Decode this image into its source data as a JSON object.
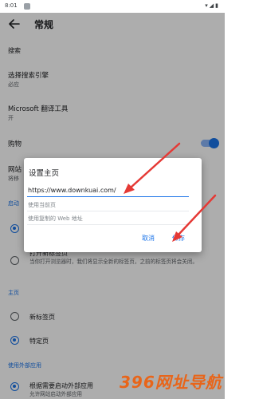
{
  "status_bar": {
    "time": "8:01",
    "indicators": "▾◢▮"
  },
  "header": {
    "title": "常规"
  },
  "settings": {
    "search_section": "搜索",
    "search_engine_title": "选择搜索引擎",
    "search_engine_value": "必应",
    "translator_title": "Microsoft 翻译工具",
    "translator_value": "开",
    "shopping_title": "购物",
    "partial_row_title": "网站",
    "partial_row_sub": "将移",
    "startup_partial": "启动",
    "open_newtab_title": "打开新标签页",
    "open_newtab_desc": "当你打开浏览器时，我们将显示全新的标签页，之前的标签页将会关闭。",
    "home_section": "主页",
    "home_newtab": "新标签页",
    "home_specific": "特定页",
    "external_apps_section": "使用外部应用",
    "external_apps_title": "根据需要启动外部应用",
    "external_apps_desc": "允许网站启动外部应用"
  },
  "dialog": {
    "title": "设置主页",
    "input_value": "https://www.downkuai.com/",
    "option_current": "使用当前页",
    "option_clipboard": "使用复制的 Web 地址",
    "cancel_label": "取消",
    "save_label": "保存"
  },
  "colors": {
    "accent": "#1a73e8",
    "annotation": "#e53935",
    "watermark": "#e8651a"
  },
  "icons": {
    "back": "arrow-left",
    "annotation": "red-arrow"
  },
  "watermark": {
    "text": "396网址导航"
  }
}
